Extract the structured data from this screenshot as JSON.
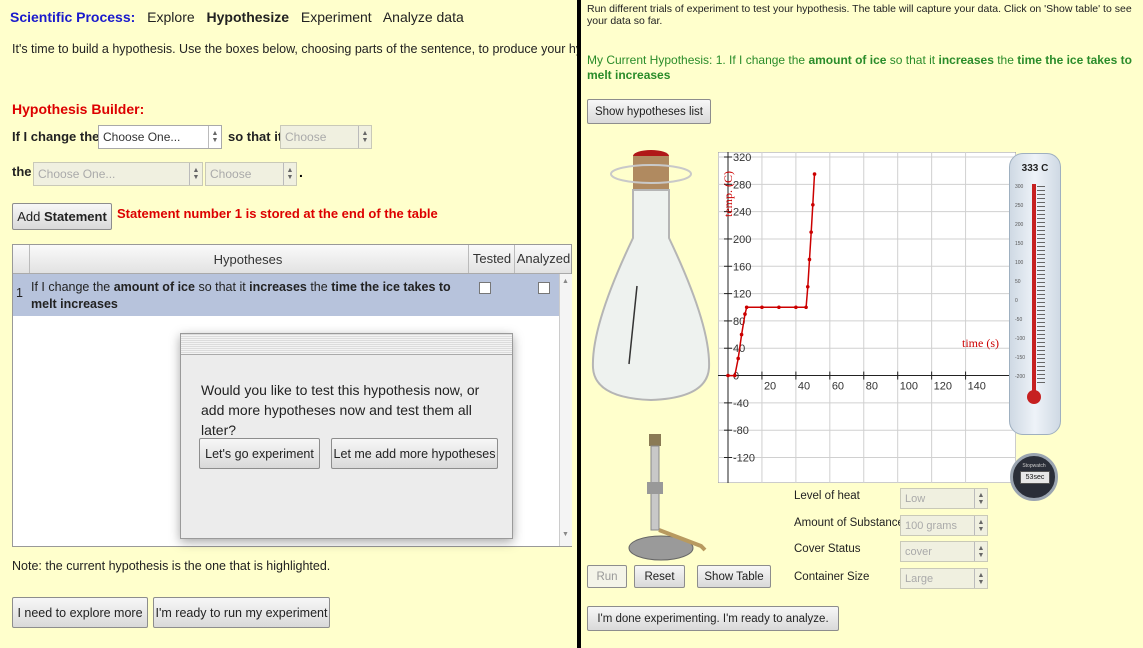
{
  "left": {
    "nav": {
      "label": "Scientific Process:",
      "items": [
        "Explore",
        "Hypothesize",
        "Experiment",
        "Analyze data"
      ]
    },
    "intro": "It's time to build a hypothesis.  Use the boxes below, choosing parts of the sentence, to produce your hypothesis.",
    "builder": {
      "title": "Hypothesis Builder:",
      "if_label": "If I change the",
      "so_label": "so that it",
      "the_label": "the",
      "period": ".",
      "variable_select": "Choose One...",
      "direction_select": "Choose",
      "outcome_select": "Choose One...",
      "result_select": "Choose"
    },
    "add_button_prefix": "Add",
    "add_button_bold": "Statement",
    "stored_message": "Statement number 1 is stored at the end of the table",
    "table": {
      "headers": {
        "hypotheses": "Hypotheses",
        "tested": "Tested",
        "analyzed": "Analyzed"
      },
      "rows": [
        {
          "num": "1",
          "t1": "If I change the ",
          "b1": "amount of ice",
          "t2": " so that it ",
          "b2": "increases",
          "t3": " the ",
          "b3": "time the ice takes to melt increases"
        }
      ]
    },
    "dialog": {
      "message": "Would you like to test this hypothesis now, or add more hypotheses now and test them all later?",
      "go_button": "Let's go experiment",
      "add_more_button": "Let me add more hypotheses"
    },
    "note": "Note: the current hypothesis is the one that is highlighted.",
    "explore_button": "I need to explore more",
    "ready_button": "I'm ready to run my experiment"
  },
  "right": {
    "instructions": "Run different trials of experiment to test your hypothesis.  The table will capture your data.  Click on 'Show table' to see your data so far.",
    "current_hypothesis": {
      "prefix": "My Current Hypothesis: 1. If I change the ",
      "b1": "amount of ice",
      "t2": " so that it ",
      "b2": "increases",
      "t3": " the ",
      "b3": "time the ice takes to melt  increases"
    },
    "show_hypotheses_button": "Show hypotheses list",
    "thermometer": {
      "reading": "333 C",
      "scale": [
        "300",
        "250",
        "200",
        "150",
        "100",
        "50",
        "0",
        "-50",
        "-100",
        "-150",
        "-200"
      ]
    },
    "stopwatch": {
      "label": "Stopwatch",
      "reading": "53sec"
    },
    "settings": [
      {
        "label": "Level of heat",
        "value": "Low"
      },
      {
        "label": "Amount of Substance",
        "value": "100 grams"
      },
      {
        "label": "Cover Status",
        "value": "cover"
      },
      {
        "label": "Container Size",
        "value": "Large"
      }
    ],
    "run_button": "Run",
    "reset_button": "Reset",
    "show_table_button": "Show Table",
    "done_button": "I'm done experimenting. I'm ready to analyze."
  },
  "colors": {
    "background": "#ffffcc",
    "nav_blue": "#1a1acc",
    "builder_red": "#dd0000",
    "hypothesis_green": "#2a8c2a",
    "curve_red": "#cc0000",
    "row_highlight": "#b7c3dc"
  },
  "chart_data": {
    "type": "line",
    "title": "",
    "xlabel": "time (s)",
    "ylabel": "temp. (C)",
    "xlim": [
      0,
      165
    ],
    "ylim": [
      -150,
      320
    ],
    "x_ticks": [
      20,
      40,
      60,
      80,
      100,
      120,
      140
    ],
    "y_ticks": [
      320,
      280,
      240,
      200,
      160,
      120,
      80,
      40,
      0,
      -40,
      -80,
      -120
    ],
    "x_tick_labels": [
      "20",
      "40",
      "60",
      "80",
      "100",
      "120",
      "140"
    ],
    "y_tick_labels": [
      "320",
      "280",
      "240",
      "200",
      "160",
      "120",
      "80",
      "40",
      "0",
      "-40",
      "-80",
      "-120"
    ],
    "grid": true,
    "series": [
      {
        "color": "#cc0000",
        "points": [
          [
            0,
            0
          ],
          [
            4,
            0
          ],
          [
            6,
            25
          ],
          [
            8,
            60
          ],
          [
            10,
            90
          ],
          [
            11,
            100
          ],
          [
            20,
            100
          ],
          [
            30,
            100
          ],
          [
            40,
            100
          ],
          [
            46,
            100
          ],
          [
            47,
            130
          ],
          [
            48,
            170
          ],
          [
            49,
            210
          ],
          [
            50,
            250
          ],
          [
            51,
            295
          ]
        ]
      }
    ]
  }
}
